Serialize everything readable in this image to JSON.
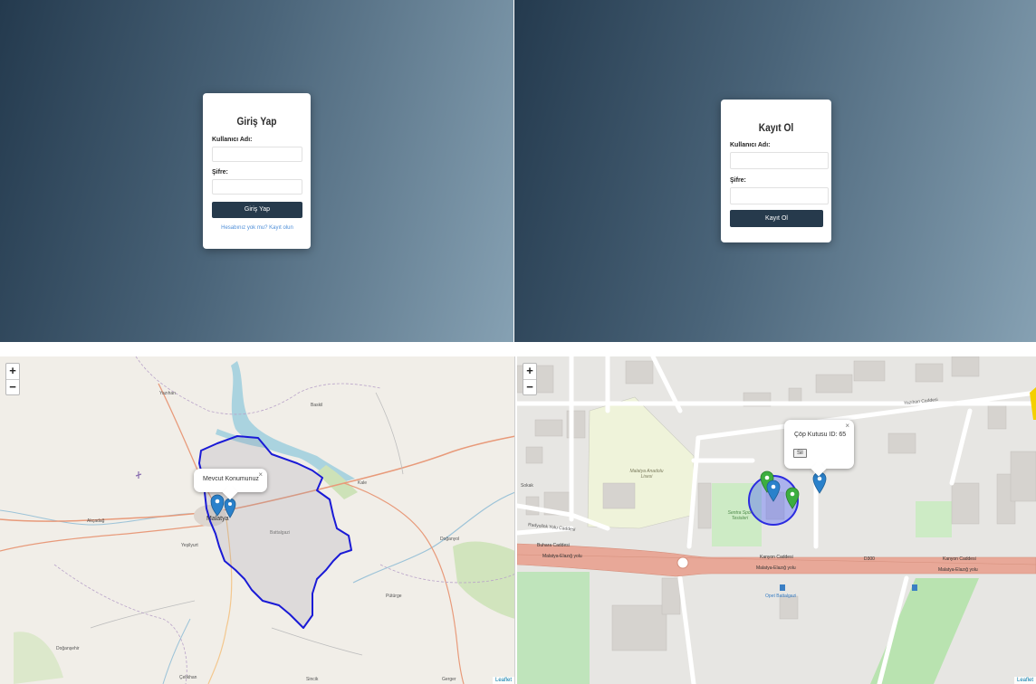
{
  "login": {
    "title": "Giriş Yap",
    "username_label": "Kullanıcı Adı:",
    "password_label": "Şifre:",
    "submit_label": "Giriş Yap",
    "register_link": "Hesabınız yok mu? Kayıt olun"
  },
  "register": {
    "title": "Kayıt Ol",
    "username_label": "Kullanıcı Adı:",
    "password_label": "Şifre:",
    "submit_label": "Kayıt Ol"
  },
  "map1": {
    "zoom_in": "+",
    "zoom_out": "−",
    "popup_text": "Mevcut Konumunuz",
    "popup_close": "×",
    "attribution": "Leaflet",
    "place_labels": [
      "Yazıhan",
      "Baskil",
      "Akçadağ",
      "Yeşilyurt",
      "Malatya",
      "Kale",
      "Doğanyol",
      "Pütürge",
      "Doğanşehir",
      "Çelikhan",
      "Sincik",
      "Gerger",
      "Battalgazi"
    ]
  },
  "map2": {
    "zoom_in": "+",
    "zoom_out": "−",
    "popup_text": "Çöp Kutusu ID: 65",
    "popup_button": "Sil",
    "popup_close": "×",
    "attribution": "Leaflet",
    "street_labels": [
      "Yazıhan Caddesi",
      "Buhara Caddesi",
      "Malatya-Elazığ yolu",
      "Kanyon Caddesi",
      "Malatya-Elazığ yolu",
      "Kanyon Caddesi",
      "Malatya-Elazığ yolu",
      "Radyolink Yolu Caddesi",
      "Sokak",
      "D300"
    ],
    "area_labels": [
      "Malatya Anadolu Lisesi",
      "Sentra Spor Tesisleri",
      "Opet Battalgazi"
    ]
  },
  "colors": {
    "background_dark": "#243a4e",
    "background_light": "#86a1b3",
    "button": "#263a4c",
    "link": "#4f8fd8",
    "boundary": "#1a1ad6",
    "marker_blue": "#2a81cb",
    "marker_green": "#3cae3f",
    "road": "#e8a898"
  }
}
